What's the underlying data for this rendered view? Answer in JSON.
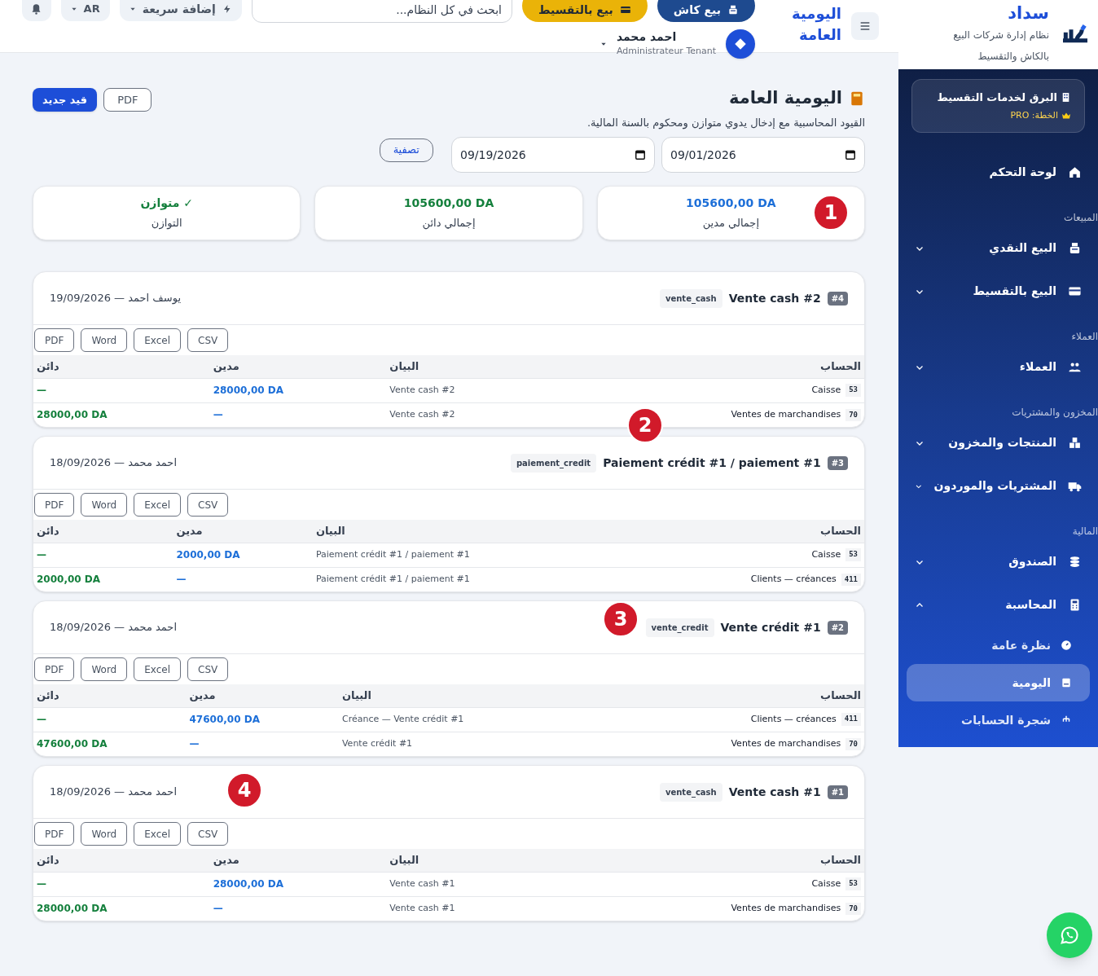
{
  "header": {
    "page_title": "اليومية العامة",
    "actions": [
      {
        "label": "بيع كاش",
        "kind": "cash"
      },
      {
        "label": "بيع بالتقسيط",
        "kind": "credit"
      }
    ],
    "search": {
      "placeholder": "ابحث في كل النظام..."
    },
    "quick_add": "إضافة سريعة",
    "language": "AR",
    "user": {
      "name": "احمد محمد",
      "role": "Administrateur Tenant"
    }
  },
  "sidebar": {
    "brand": {
      "name": "سداد",
      "tagline": "نظام إدارة شركات البيع بالكاش والتقسيط"
    },
    "tenant": {
      "name": "البرق لخدمات التقسيط",
      "plan": "الخطة: PRO"
    },
    "items": [
      {
        "kind": "link",
        "label": "لوحة التحكم",
        "selected": false
      },
      {
        "kind": "section",
        "label": "المبيعات"
      },
      {
        "kind": "link",
        "label": "البيع النقدي",
        "selected": false,
        "expanded": false
      },
      {
        "kind": "link",
        "label": "البيع بالتقسيط",
        "selected": false,
        "expanded": false
      },
      {
        "kind": "section",
        "label": "العملاء"
      },
      {
        "kind": "link",
        "label": "العملاء",
        "selected": false,
        "expanded": false
      },
      {
        "kind": "section",
        "label": "المخزون والمشتريات"
      },
      {
        "kind": "link",
        "label": "المنتجات والمخزون",
        "selected": false,
        "expanded": false
      },
      {
        "kind": "link",
        "label": "المشتريات والموردون",
        "selected": false,
        "expanded": false
      },
      {
        "kind": "section",
        "label": "المالية"
      },
      {
        "kind": "link",
        "label": "الصندوق",
        "selected": false,
        "expanded": false
      },
      {
        "kind": "link",
        "label": "المحاسبة",
        "selected": false,
        "expanded": true,
        "children": [
          {
            "label": "نظرة عامة",
            "selected": false
          },
          {
            "label": "اليومية",
            "selected": true
          },
          {
            "label": "شجرة الحسابات",
            "selected": false
          }
        ]
      }
    ]
  },
  "page": {
    "title": "اليومية العامة",
    "subtitle": "القيود المحاسبية مع إدخال يدوي متوازن ومحكوم بالسنة المالية.",
    "new_button": "قيد جديد",
    "pdf_button": "PDF",
    "filters": {
      "from": "09/01/2026",
      "to": "09/19/2026",
      "apply": "تصفية"
    },
    "stats": [
      {
        "kind": "debit",
        "value": "105600,00 DA",
        "label": "إجمالي مدين"
      },
      {
        "kind": "credit",
        "value": "105600,00 DA",
        "label": "إجمالي دائن"
      },
      {
        "kind": "balance",
        "value": "✓ متوازن",
        "label": "التوازن"
      }
    ],
    "entries": [
      {
        "number": "#4",
        "title": "Vente cash #2",
        "type": "vente_cash",
        "meta": "يوسف احمد — 19/09/2026",
        "exports": [
          "CSV",
          "Excel",
          "Word",
          "PDF"
        ],
        "columns": [
          "الحساب",
          "البيان",
          "مدين",
          "دائن"
        ],
        "rows": [
          {
            "code": "53",
            "account": "Caisse",
            "label": "Vente cash #2",
            "debit": "28000,00 DA",
            "credit": "—"
          },
          {
            "code": "70",
            "account": "Ventes de marchandises",
            "label": "Vente cash #2",
            "debit": "—",
            "credit": "28000,00 DA"
          }
        ]
      },
      {
        "number": "#3",
        "title": "Paiement crédit #1 / paiement #1",
        "type": "paiement_credit",
        "meta": "احمد محمد — 18/09/2026",
        "exports": [
          "CSV",
          "Excel",
          "Word",
          "PDF"
        ],
        "columns": [
          "الحساب",
          "البيان",
          "مدين",
          "دائن"
        ],
        "rows": [
          {
            "code": "53",
            "account": "Caisse",
            "label": "Paiement crédit #1 / paiement #1",
            "debit": "2000,00 DA",
            "credit": "—"
          },
          {
            "code": "411",
            "account": "Clients — créances",
            "label": "Paiement crédit #1 / paiement #1",
            "debit": "—",
            "credit": "2000,00 DA"
          }
        ]
      },
      {
        "number": "#2",
        "title": "Vente crédit #1",
        "type": "vente_credit",
        "meta": "احمد محمد — 18/09/2026",
        "exports": [
          "CSV",
          "Excel",
          "Word",
          "PDF"
        ],
        "columns": [
          "الحساب",
          "البيان",
          "مدين",
          "دائن"
        ],
        "rows": [
          {
            "code": "411",
            "account": "Clients — créances",
            "label": "Créance — Vente crédit #1",
            "debit": "47600,00 DA",
            "credit": "—"
          },
          {
            "code": "70",
            "account": "Ventes de marchandises",
            "label": "Vente crédit #1",
            "debit": "—",
            "credit": "47600,00 DA"
          }
        ]
      },
      {
        "number": "#1",
        "title": "Vente cash #1",
        "type": "vente_cash",
        "meta": "احمد محمد — 18/09/2026",
        "exports": [
          "CSV",
          "Excel",
          "Word",
          "PDF"
        ],
        "columns": [
          "الحساب",
          "البيان",
          "مدين",
          "دائن"
        ],
        "rows": [
          {
            "code": "53",
            "account": "Caisse",
            "label": "Vente cash #1",
            "debit": "28000,00 DA",
            "credit": "—"
          },
          {
            "code": "70",
            "account": "Ventes de marchandises",
            "label": "Vente cash #1",
            "debit": "—",
            "credit": "28000,00 DA"
          }
        ]
      }
    ]
  },
  "markers": [
    "1",
    "2",
    "3",
    "4"
  ]
}
